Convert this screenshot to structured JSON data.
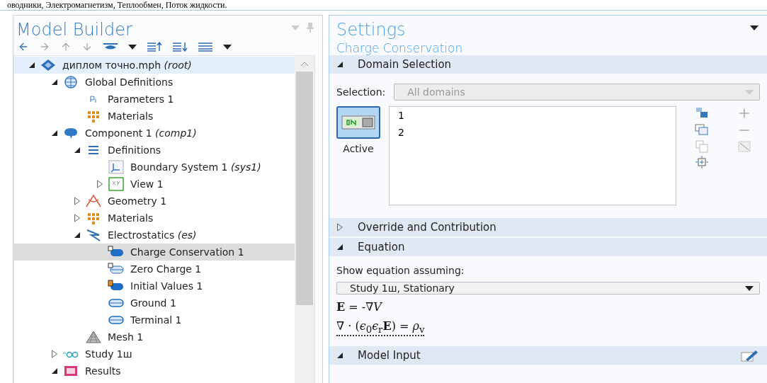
{
  "document_text": "оводники, Электромагнетизм, Теплообмен, Поток жидкости.",
  "model_builder": {
    "title": "Model Builder",
    "tree": [
      {
        "label": "диплом точно.mph *(root)*",
        "kind": "model",
        "expanded": true,
        "selected": false,
        "highlighted": true,
        "children": [
          {
            "label": "Global Definitions",
            "kind": "globe",
            "expanded": true,
            "selected": false,
            "children": [
              {
                "label": "Parameters 1",
                "kind": "pi",
                "selected": false
              },
              {
                "label": "Materials",
                "kind": "materials",
                "selected": false
              }
            ]
          },
          {
            "label": "Component 1 *(comp1)*",
            "kind": "component",
            "expanded": true,
            "selected": false,
            "children": [
              {
                "label": "Definitions",
                "kind": "definitions",
                "expanded": true,
                "selected": false,
                "children": [
                  {
                    "label": "Boundary System 1 *(sys1)*",
                    "kind": "system",
                    "selected": false
                  },
                  {
                    "label": "View 1",
                    "kind": "view",
                    "expanded": false,
                    "selected": false
                  }
                ]
              },
              {
                "label": "Geometry 1",
                "kind": "geometry",
                "expanded": false,
                "selected": false
              },
              {
                "label": "Materials",
                "kind": "materials",
                "expanded": false,
                "selected": false
              },
              {
                "label": "Electrostatics *(es)*",
                "kind": "physics",
                "expanded": true,
                "selected": false,
                "children": [
                  {
                    "label": "Charge Conservation 1",
                    "kind": "domain-solid",
                    "selected": true
                  },
                  {
                    "label": "Zero Charge 1",
                    "kind": "domain-outline",
                    "selected": false
                  },
                  {
                    "label": "Initial Values 1",
                    "kind": "domain-init",
                    "selected": false
                  },
                  {
                    "label": "Ground 1",
                    "kind": "boundary",
                    "selected": false
                  },
                  {
                    "label": "Terminal 1",
                    "kind": "boundary",
                    "selected": false
                  }
                ]
              },
              {
                "label": "Mesh 1",
                "kind": "mesh",
                "selected": false
              }
            ]
          },
          {
            "label": "Study 1ш",
            "kind": "study",
            "expanded": false,
            "selected": false
          },
          {
            "label": "Results",
            "kind": "results",
            "expanded": true,
            "selected": false
          }
        ]
      }
    ]
  },
  "settings": {
    "title": "Settings",
    "subtitle": "Charge Conservation",
    "sections": [
      {
        "kind": "selection",
        "title": "Domain Selection",
        "expanded": true,
        "selection_label": "Selection:",
        "selection_value": "All domains",
        "active": true,
        "active_label": "Active",
        "entities": [
          "1",
          "2"
        ]
      },
      {
        "kind": "collapsed",
        "title": "Override and Contribution",
        "expanded": false
      },
      {
        "kind": "equation",
        "title": "Equation",
        "expanded": true,
        "assume_label": "Show equation assuming:",
        "study_value": "Study 1ш, Stationary",
        "equations": [
          "**E** = -∇*V*",
          "∇ · (*ϵ*$_{0}$*ϵ*$_{r}$**E**) = *ρ*$_{v}$"
        ]
      },
      {
        "kind": "input",
        "title": "Model Input",
        "expanded": true
      }
    ]
  }
}
